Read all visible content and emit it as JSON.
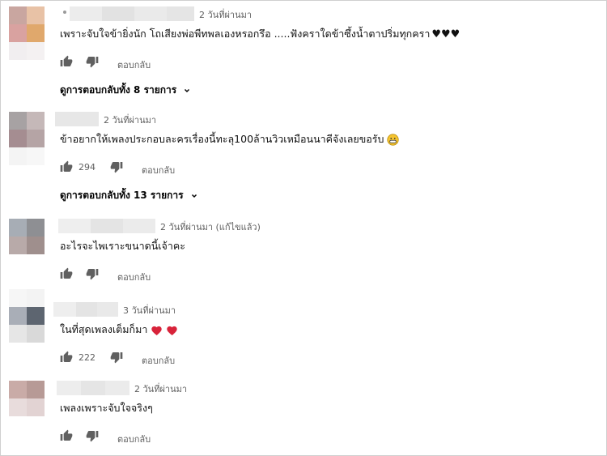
{
  "comments": [
    {
      "time": "2 วันที่ผ่านมา",
      "text": "เพราะจับใจข้ายิ่งนัก โถเสียงพ่อพีทพลเองหรอกรึอ .....ฟังคราใดข้าซึ้งน้ำตาปริ่มทุกครา",
      "text_suffix": "♥♥♥",
      "likes": "",
      "reply_label": "ตอบกลับ",
      "view_replies": "ดูการตอบกลับทั้ง 8 รายการ"
    },
    {
      "time": "2 วันที่ผ่านมา",
      "text": "ข้าอยากให้เพลงประกอบละครเรื่องนี้ทะลุ100ล้านวิวเหมือนนาคีจังเลยขอรับ",
      "likes": "294",
      "reply_label": "ตอบกลับ",
      "view_replies": "ดูการตอบกลับทั้ง 13 รายการ"
    },
    {
      "time": "2 วันที่ผ่านมา (แก้ไขแล้ว)",
      "text": "อะไรจะไพเราะขนาดนี้เจ้าคะ",
      "likes": "",
      "reply_label": "ตอบกลับ"
    },
    {
      "time": "3 วันที่ผ่านมา",
      "text": "ในที่สุดเพลงเต็มก็มา",
      "likes": "222",
      "reply_label": "ตอบกลับ"
    },
    {
      "time": "2 วันที่ผ่านมา",
      "text": "เพลงเพราะจับใจจริงๆ",
      "likes": "",
      "reply_label": "ตอบกลับ"
    }
  ],
  "colors": {
    "meta": "#606060",
    "text": "#030303",
    "heart": "#d8233a",
    "emoji": "#f5c431"
  }
}
